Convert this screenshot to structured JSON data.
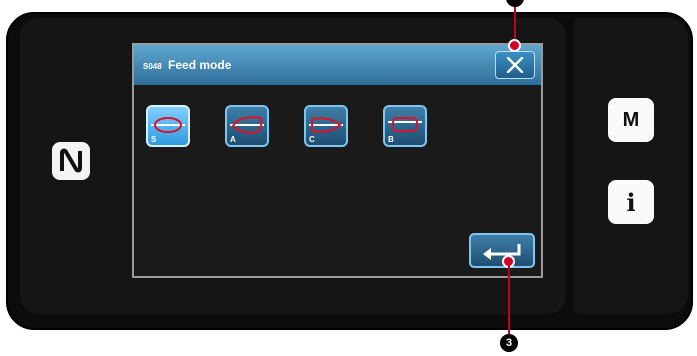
{
  "dialog": {
    "code": "S048",
    "title": "Feed mode",
    "close_icon": "close-x-icon",
    "enter_icon": "enter-return-icon"
  },
  "feed_modes": [
    {
      "letter": "S",
      "selected": true
    },
    {
      "letter": "A",
      "selected": false
    },
    {
      "letter": "C",
      "selected": false
    },
    {
      "letter": "B",
      "selected": false
    }
  ],
  "side_panel": {
    "menu_label": "M",
    "info_label": "i"
  },
  "callouts": {
    "enter_number": "3"
  },
  "colors": {
    "title_bar": "#3b8cc0",
    "button_border": "#7fc6ee",
    "callout_red": "#d6002a",
    "loop_red": "#e0102a"
  }
}
